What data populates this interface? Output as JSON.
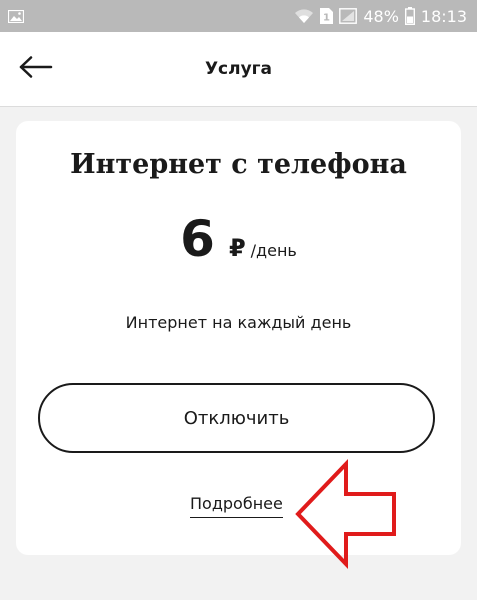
{
  "status_bar": {
    "sim_label": "1",
    "battery": "48%",
    "time": "18:13"
  },
  "header": {
    "title": "Услуга"
  },
  "service": {
    "name": "Интернет с телефона",
    "price": "6",
    "currency": "₽",
    "price_unit": "/день",
    "description": "Интернет на каждый день",
    "disable_label": "Отключить",
    "details_label": "Подробнее"
  },
  "colors": {
    "status_bar_bg": "#b9b9b9",
    "page_bg": "#f2f2f2",
    "text": "#1a1a1a",
    "annotation_red": "#e01b1b"
  },
  "icons": {
    "status_left": "gallery-icon",
    "wifi": "wifi-icon",
    "sim": "sim-icon",
    "signal": "signal-icon",
    "battery": "battery-icon",
    "back": "arrow-left-icon",
    "annotation": "red-arrow-icon"
  }
}
